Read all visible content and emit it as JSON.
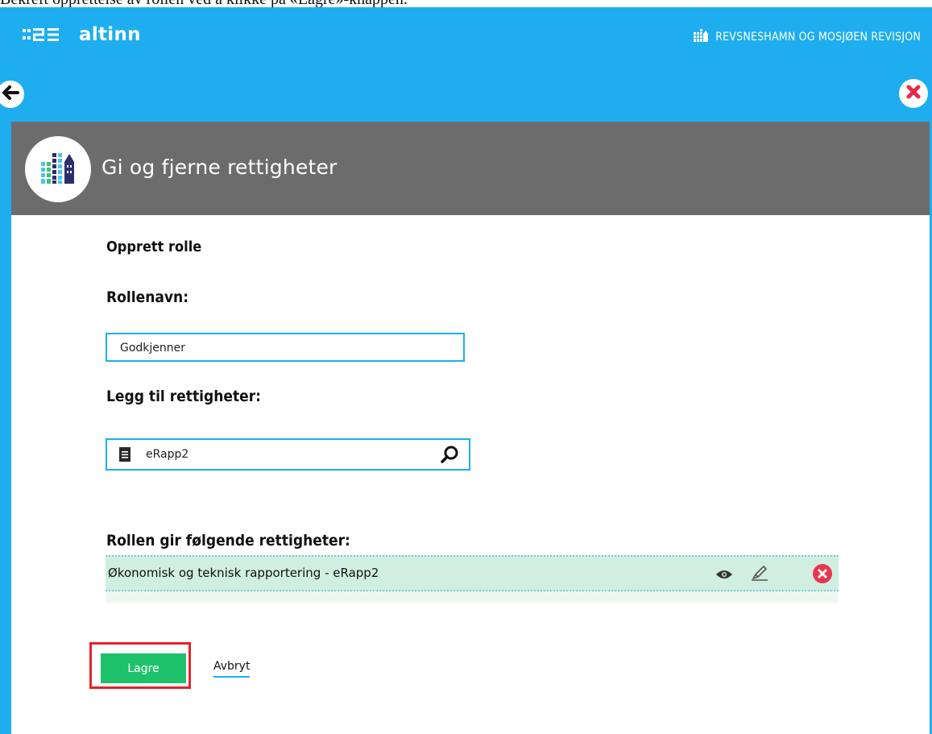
{
  "instruction_text": "Bekreft opprettelse av rollen ved å klikke på «Lagre»-knappen.",
  "topbar": {
    "logo_text": "altinn",
    "org_name": "REVSNESHAMN OG MOSJØEN REVISJON"
  },
  "panel": {
    "title": "Gi og fjerne rettigheter"
  },
  "form": {
    "heading": "Opprett rolle",
    "role_name_label": "Rollenavn:",
    "role_name_value": "Godkjenner",
    "add_rights_label": "Legg til rettigheter:",
    "search_value": "eRapp2",
    "granted_label": "Rollen gir følgende rettigheter:",
    "rights": [
      {
        "name": "Økonomisk og teknisk rapportering - eRapp2"
      }
    ]
  },
  "actions": {
    "save_label": "Lagre",
    "cancel_label": "Avbryt"
  },
  "colors": {
    "brand_blue": "#1eaef0",
    "header_gray": "#6c6c6c",
    "save_green": "#1ec26a",
    "rights_row": "#d0efe1",
    "remove_red": "#e8384f",
    "highlight_red": "#e2232b"
  },
  "icons": [
    "altinn-logo-icon",
    "building-icon",
    "back-arrow-icon",
    "close-icon",
    "document-icon",
    "search-icon",
    "eye-icon",
    "edit-icon",
    "remove-icon"
  ]
}
